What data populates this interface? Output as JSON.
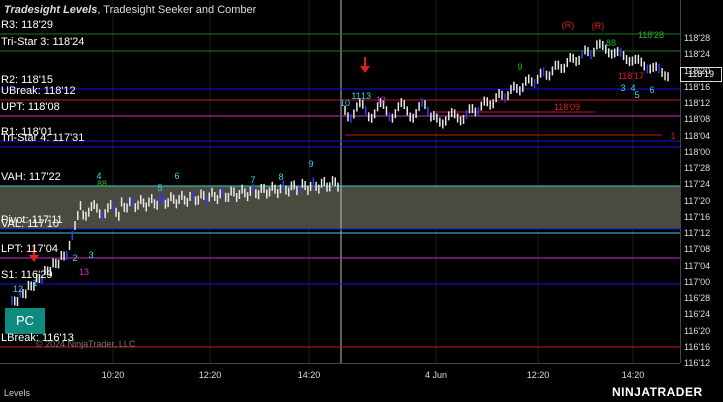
{
  "title": {
    "instrument": "Tradesight Levels",
    "studies": ", Tradesight Seeker and Comber"
  },
  "f_button": "F",
  "pc_button": "PC",
  "copyright": "© 2024 NinjaTrader, LLC",
  "tab": "Levels",
  "brand": "NINJATRADER",
  "current_price": "118'19",
  "colors": {
    "resistance": "#1414e0",
    "green_level": "#1a7a2a",
    "red_level": "#c81919",
    "value_area": "#3ccfcf",
    "magenta": "#c832c8",
    "cyan_count": "#2fd7f0",
    "green_count": "#2bb02b",
    "red_count": "#e02020",
    "band_fill": "#4b4a40"
  },
  "price_axis": [
    "118'28",
    "118'24",
    "118'20",
    "118'16",
    "118'12",
    "118'08",
    "118'04",
    "118'00",
    "117'28",
    "117'24",
    "117'20",
    "117'16",
    "117'12",
    "117'08",
    "117'04",
    "117'00",
    "116'28",
    "116'24",
    "116'20",
    "116'16",
    "116'12"
  ],
  "time_axis": [
    "10:20",
    "12:20",
    "14:20",
    "4 Jun",
    "12:20",
    "14:20"
  ],
  "levels": [
    {
      "label": "R3: 118'29",
      "color": "green"
    },
    {
      "label": "Tri-Star 3: 118'24",
      "color": "green"
    },
    {
      "label": "R2: 118'15",
      "color": "resistance"
    },
    {
      "label": "UBreak: 118'12",
      "color": "red"
    },
    {
      "label": "UPT: 118'08",
      "color": "magenta"
    },
    {
      "label": "R1: 118'01",
      "color": "resistance"
    },
    {
      "label": "Tri-Star 4: 117'31",
      "color": "resistance"
    },
    {
      "label": "VAH: 117'22",
      "color": "value_area"
    },
    {
      "label": "Pivot: 117'11",
      "color": "resistance"
    },
    {
      "label": "VAL: 117'10",
      "color": "value_area"
    },
    {
      "label": "LPT: 117'04",
      "color": "magenta"
    },
    {
      "label": "S1: 116'29",
      "color": "resistance"
    },
    {
      "label": "LBreak: 116'13",
      "color": "red"
    }
  ],
  "annotations": {
    "seeker_counts_day1": [
      "1",
      "2",
      "4",
      "5",
      "6",
      "7",
      "8",
      "9",
      "1",
      "2",
      "3",
      "12"
    ],
    "seeker_counts_day2": [
      "10",
      "11",
      "12",
      "13",
      "9",
      "1",
      "2",
      "3",
      "4",
      "5",
      "6"
    ],
    "green_counts": [
      "88",
      "88",
      "4",
      "12",
      "9"
    ],
    "red_markers": [
      "(R)",
      "(R)",
      "118'09",
      "118'17",
      "1",
      "11"
    ],
    "magenta_counts": [
      "13",
      "12"
    ]
  }
}
